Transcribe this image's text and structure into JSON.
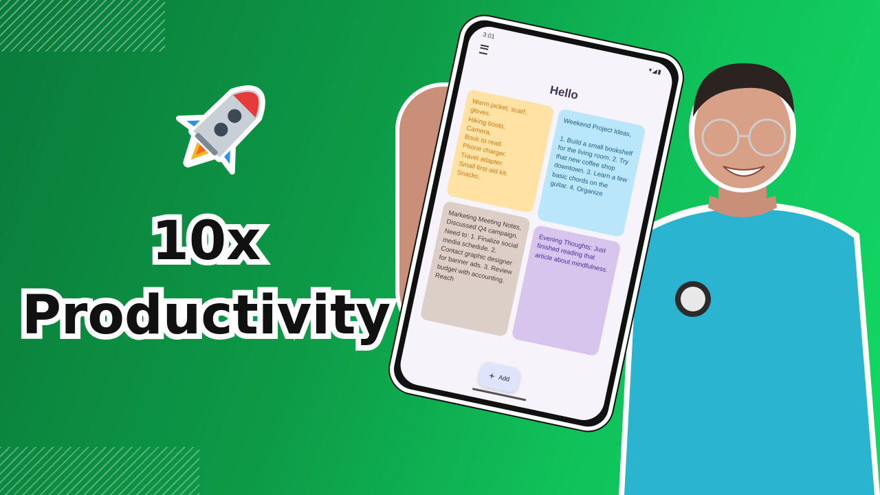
{
  "headline": {
    "line1": "10x",
    "line2": "Productivity"
  },
  "phone": {
    "status_time": "3:01",
    "status_icons": "▾◢▮",
    "app_title": "Hello",
    "notes": [
      {
        "text": "Warm jacket, scarf, gloves.\nHiking boots.\nCamera.\nBook to read.\nPhone charger.\nTravel adapter.\nSmall first-aid kit.\nSnacks."
      },
      {
        "text": "Weekend Project Ideas,\n\n1. Build a small bookshelf for the living room. 2. Try that new coffee shop downtown. 3. Learn a few basic chords on the guitar. 4. Organize"
      },
      {
        "text": "Marketing Meeting Notes,\nDiscussed Q4 campaign. Need to: 1. Finalize social media schedule. 2. Contact graphic designer for banner ads. 3. Review budget with accounting. Reach"
      },
      {
        "text": "Evening Thoughts: Just finished reading that article about mindfulness."
      }
    ],
    "add_button": {
      "icon": "+",
      "label": "Add"
    }
  },
  "colors": {
    "background_start": "#0a7a3a",
    "background_end": "#12d865",
    "shirt": "#2bb4cf"
  }
}
